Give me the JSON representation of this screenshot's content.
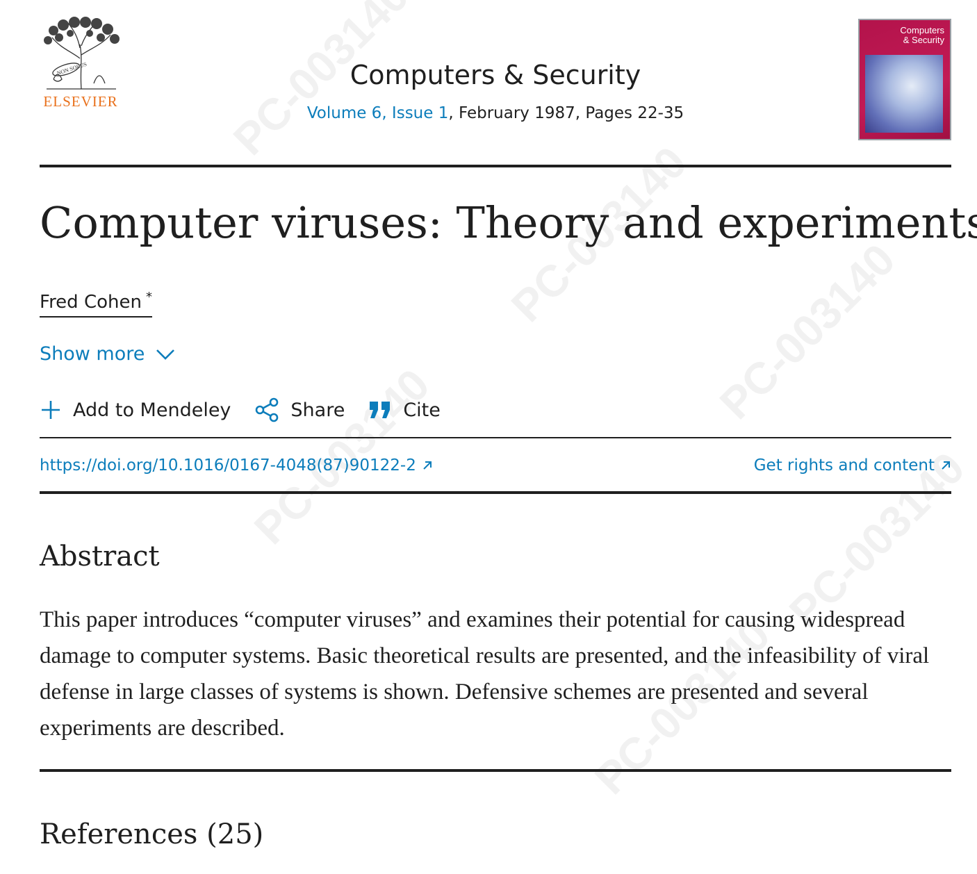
{
  "publisher": {
    "name": "ELSEVIER",
    "motto": "NON SOLUS"
  },
  "journal": {
    "title": "Computers & Security",
    "issue_link": "Volume 6, Issue 1",
    "issue_rest": ", February 1987, Pages 22-35",
    "cover_title": "Computers & Security"
  },
  "article": {
    "title": "Computer viruses: Theory and experiments",
    "author": "Fred Cohen",
    "author_mark": "*",
    "show_more": "Show more"
  },
  "toolbar": {
    "mendeley": "Add to Mendeley",
    "share": "Share",
    "cite": "Cite"
  },
  "links": {
    "doi": "https://doi.org/10.1016/0167-4048(87)90122-2",
    "rights": "Get rights and content"
  },
  "abstract": {
    "heading": "Abstract",
    "text": "This paper introduces “computer viruses” and examines their potential for causing widespread damage to computer systems. Basic theoretical results are presented, and the infeasibility of viral defense in large classes of systems is shown. Defensive schemes are presented and several experiments are described."
  },
  "references": {
    "heading": "References (25)"
  },
  "watermark": "PC-003140",
  "colors": {
    "link": "#0c7dbb",
    "publisher": "#e9711c",
    "text": "#1f1f1f"
  }
}
